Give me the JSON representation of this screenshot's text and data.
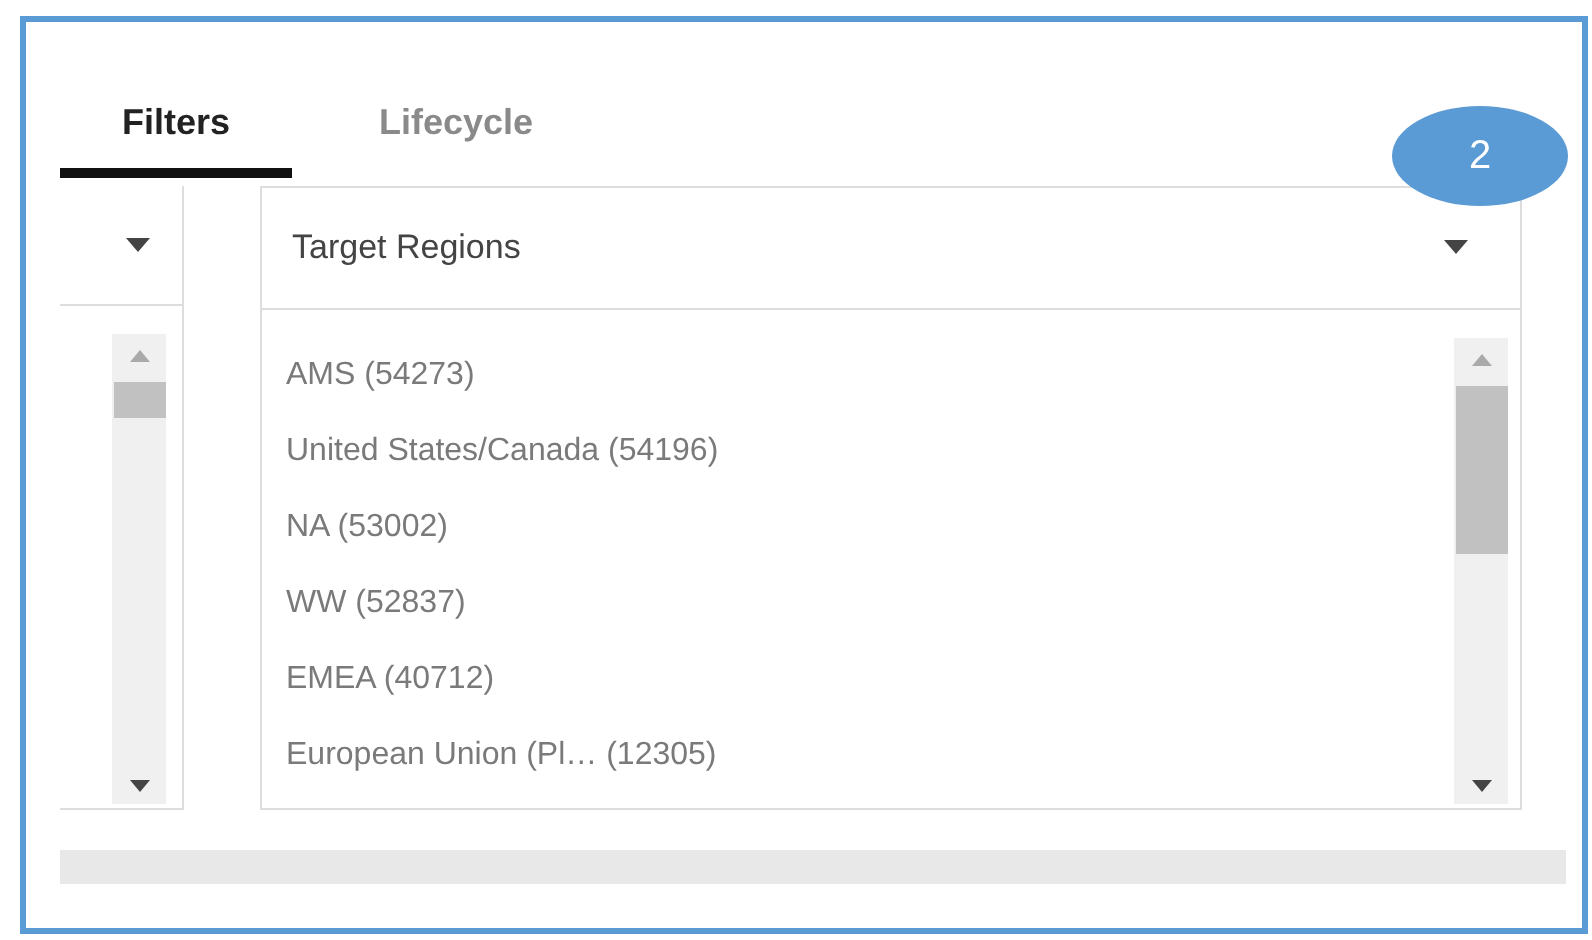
{
  "tabs": [
    {
      "label": "Filters",
      "selected": true
    },
    {
      "label": "Lifecycle",
      "selected": false
    }
  ],
  "callout": {
    "label": "2"
  },
  "region_filter": {
    "title": "Target Regions",
    "items": [
      {
        "label": "AMS (54273)"
      },
      {
        "label": "United States/Canada (54196)"
      },
      {
        "label": "NA (53002)"
      },
      {
        "label": "WW (52837)"
      },
      {
        "label": "EMEA (40712)"
      },
      {
        "label": "European Union (Pl… (12305)"
      }
    ]
  }
}
